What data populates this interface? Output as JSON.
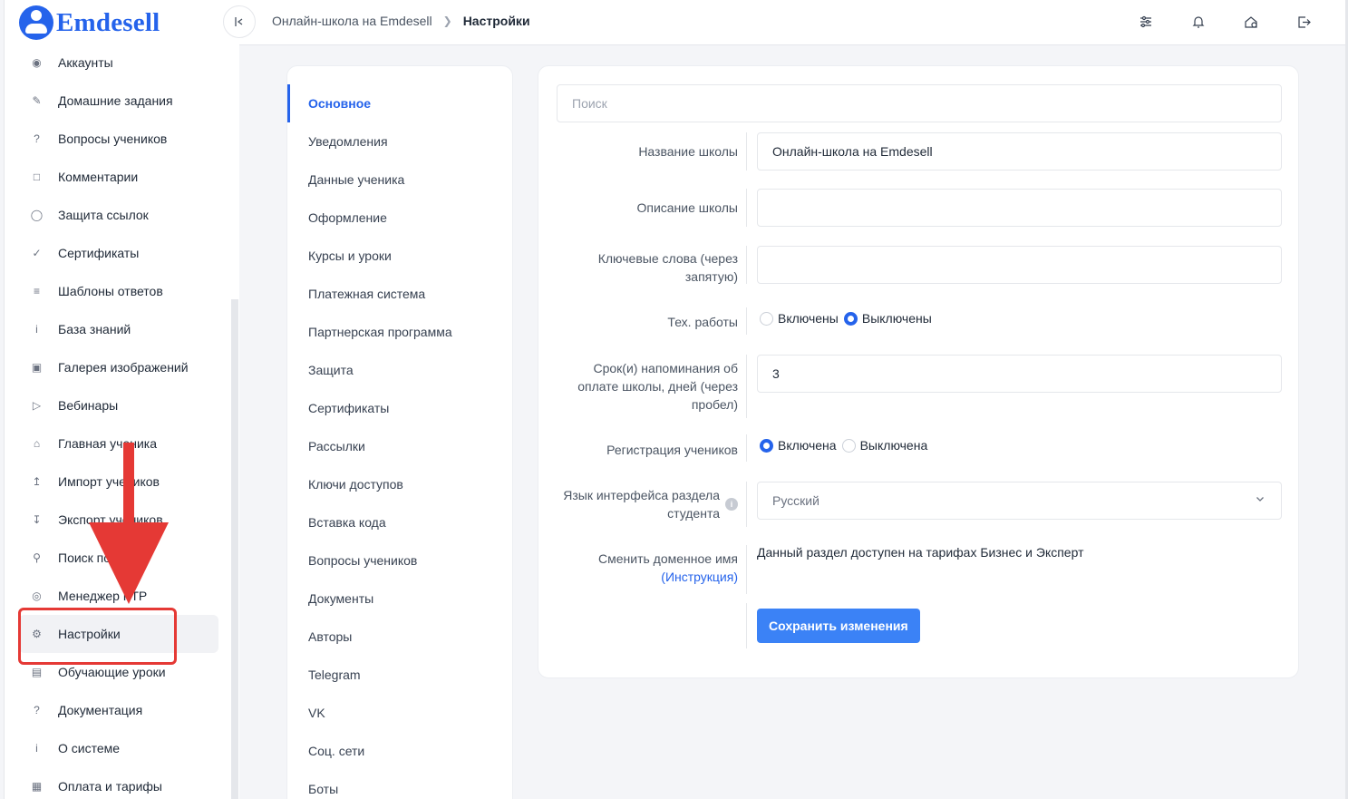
{
  "brand": {
    "name": "Emdesell"
  },
  "sidebar": {
    "items": [
      {
        "label": "Аккаунты",
        "icon": "users-icon"
      },
      {
        "label": "Домашние задания",
        "icon": "pencil-icon"
      },
      {
        "label": "Вопросы учеников",
        "icon": "question-circle-icon"
      },
      {
        "label": "Комментарии",
        "icon": "comment-icon"
      },
      {
        "label": "Защита ссылок",
        "icon": "shield-icon"
      },
      {
        "label": "Сертификаты",
        "icon": "check-circle-icon"
      },
      {
        "label": "Шаблоны ответов",
        "icon": "list-icon"
      },
      {
        "label": "База знаний",
        "icon": "info-circle-icon"
      },
      {
        "label": "Галерея изображений",
        "icon": "image-icon"
      },
      {
        "label": "Вебинары",
        "icon": "play-icon"
      },
      {
        "label": "Главная ученика",
        "icon": "home-icon"
      },
      {
        "label": "Импорт учеников",
        "icon": "upload-icon"
      },
      {
        "label": "Экспорт учеников",
        "icon": "download-icon"
      },
      {
        "label": "Поиск по сайту",
        "icon": "search-icon"
      },
      {
        "label": "Менеджер FTP",
        "icon": "disc-icon"
      },
      {
        "label": "Настройки",
        "icon": "gear-icon",
        "active": true
      },
      {
        "label": "Обучающие уроки",
        "icon": "film-icon"
      },
      {
        "label": "Документация",
        "icon": "help-square-icon"
      },
      {
        "label": "О системе",
        "icon": "info-square-icon"
      },
      {
        "label": "Оплата и тарифы",
        "icon": "calculator-icon"
      }
    ]
  },
  "topbar": {
    "breadcrumb": {
      "parent": "Онлайн-школа на Emdesell",
      "current": "Настройки"
    },
    "icons": [
      "sliders-icon",
      "bell-icon",
      "home-gear-icon",
      "logout-icon"
    ]
  },
  "settings_menu": {
    "items": [
      {
        "label": "Основное",
        "active": true
      },
      {
        "label": "Уведомления"
      },
      {
        "label": "Данные ученика"
      },
      {
        "label": "Оформление"
      },
      {
        "label": "Курсы и уроки"
      },
      {
        "label": "Платежная система"
      },
      {
        "label": "Партнерская программа"
      },
      {
        "label": "Защита"
      },
      {
        "label": "Сертификаты"
      },
      {
        "label": "Рассылки"
      },
      {
        "label": "Ключи доступов"
      },
      {
        "label": "Вставка кода"
      },
      {
        "label": "Вопросы учеников"
      },
      {
        "label": "Документы"
      },
      {
        "label": "Авторы"
      },
      {
        "label": "Telegram"
      },
      {
        "label": "VK"
      },
      {
        "label": "Соц. сети"
      },
      {
        "label": "Боты"
      }
    ]
  },
  "form": {
    "search_placeholder": "Поиск",
    "school_name": {
      "label": "Название школы",
      "value": "Онлайн-школа на Emdesell"
    },
    "school_description": {
      "label": "Описание школы",
      "value": ""
    },
    "keywords": {
      "label_line1": "Ключевые слова (через",
      "label_line2": "запятую)",
      "value": ""
    },
    "maintenance": {
      "label": "Тех. работы",
      "option_on": "Включены",
      "option_off": "Выключены",
      "selected": "off"
    },
    "reminder": {
      "label_line1": "Срок(и) напоминания об",
      "label_line2": "оплате школы, дней (через",
      "label_line3": "пробел)",
      "value": "3"
    },
    "registration": {
      "label": "Регистрация учеников",
      "option_on": "Включена",
      "option_off": "Выключена",
      "selected": "on"
    },
    "language": {
      "label_line1": "Язык интерфейса раздела",
      "label_line2": "студента",
      "value": "Русский"
    },
    "domain": {
      "label": "Сменить доменное имя",
      "link": "(Инструкция)",
      "text": "Данный раздел доступен на тарифах Бизнес и Эксперт"
    },
    "save_label": "Сохранить изменения"
  },
  "colors": {
    "accent": "#2563eb",
    "annotation": "#e53935"
  }
}
